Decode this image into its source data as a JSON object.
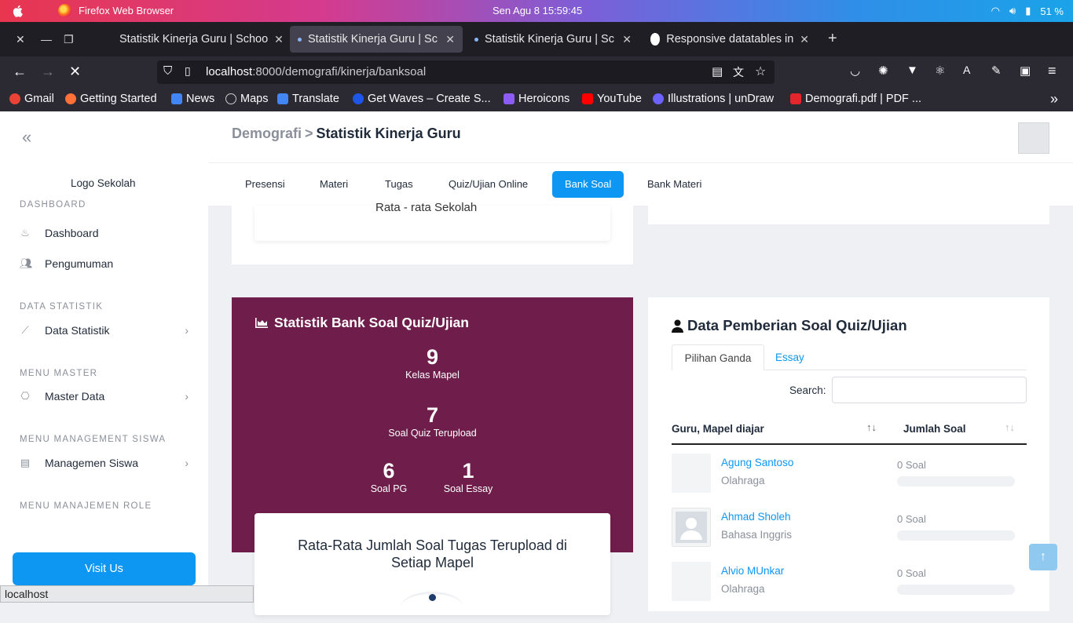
{
  "os": {
    "app_title": "Firefox Web Browser",
    "clock": "Sen Agu 8  15:59:45",
    "battery": "51 %"
  },
  "browser": {
    "tabs": [
      {
        "label": "Statistik Kinerja Guru | Schoo"
      },
      {
        "label": "Statistik Kinerja Guru | Sc"
      },
      {
        "label": "Statistik Kinerja Guru | Sc"
      },
      {
        "label": "Responsive datatables in"
      }
    ],
    "url_host": "localhost",
    "url_path": ":8000/demografi/kinerja/banksoal",
    "bookmarks": [
      {
        "label": "Gmail",
        "color": "#ea4335"
      },
      {
        "label": "Getting Started",
        "color": "#ff7139"
      },
      {
        "label": "News",
        "color": "#4285f4"
      },
      {
        "label": "Maps",
        "color": "#cccccc"
      },
      {
        "label": "Translate",
        "color": "#4285f4"
      },
      {
        "label": "Get Waves – Create S...",
        "color": "#1e56e8"
      },
      {
        "label": "Heroicons",
        "color": "#8b5cf6"
      },
      {
        "label": "YouTube",
        "color": "#ff0000"
      },
      {
        "label": "Illustrations | unDraw",
        "color": "#6c63ff"
      },
      {
        "label": "Demografi.pdf | PDF ...",
        "color": "#e3262b"
      }
    ],
    "status_text": "localhost"
  },
  "sidebar": {
    "logo_text": "Logo Sekolah",
    "sections": [
      {
        "header": "DASHBOARD",
        "items": [
          {
            "label": "Dashboard",
            "icon": "fire-icon"
          },
          {
            "label": "Pengumuman",
            "icon": "users-icon"
          }
        ]
      },
      {
        "header": "DATA STATISTIK",
        "items": [
          {
            "label": "Data Statistik",
            "icon": "chart-line-icon"
          }
        ]
      },
      {
        "header": "MENU MASTER",
        "items": [
          {
            "label": "Master Data",
            "icon": "bookmark-icon"
          }
        ]
      },
      {
        "header": "MENU MANAGEMENT SISWA",
        "items": [
          {
            "label": "Managemen Siswa",
            "icon": "id-card-icon"
          }
        ]
      },
      {
        "header": "MENU MANAJEMEN ROLE",
        "items": []
      }
    ],
    "visit_button": "Visit Us"
  },
  "header": {
    "crumb_parent": "Demografi",
    "crumb_sep": ">",
    "crumb_current": "Statistik Kinerja Guru"
  },
  "page_tabs": [
    {
      "label": "Presensi",
      "active": false
    },
    {
      "label": "Materi",
      "active": false
    },
    {
      "label": "Tugas",
      "active": false
    },
    {
      "label": "Quiz/Ujian Online",
      "active": false
    },
    {
      "label": "Bank Soal",
      "active": true
    },
    {
      "label": "Bank Materi",
      "active": false
    }
  ],
  "top_card": {
    "partial_text": "Rata - rata Sekolah"
  },
  "stats": {
    "title": "Statistik Bank Soal Quiz/Ujian",
    "kelas_mapel": {
      "value": "9",
      "label": "Kelas Mapel"
    },
    "soal_quiz": {
      "value": "7",
      "label": "Soal Quiz Terupload"
    },
    "soal_pg": {
      "value": "6",
      "label": "Soal PG"
    },
    "soal_essay": {
      "value": "1",
      "label": "Soal Essay"
    }
  },
  "chart_card": {
    "title": "Rata-Rata Jumlah Soal Tugas Terupload di Setiap Mapel"
  },
  "right_card": {
    "title": "Data Pemberian Soal Quiz/Ujian",
    "tab_pg": "Pilihan Ganda",
    "tab_essay": "Essay",
    "search_label": "Search:",
    "col_guru": "Guru, Mapel diajar",
    "col_jumlah": "Jumlah Soal",
    "rows": [
      {
        "name": "Agung Santoso",
        "subject": "Olahraga",
        "soal": "0 Soal"
      },
      {
        "name": "Ahmad Sholeh",
        "subject": "Bahasa Inggris",
        "soal": "0 Soal"
      },
      {
        "name": "Alvio MUnkar",
        "subject": "Olahraga",
        "soal": "0 Soal"
      }
    ]
  },
  "colors": {
    "accent": "#0d96f2",
    "purple_card": "#6f1d4b"
  }
}
